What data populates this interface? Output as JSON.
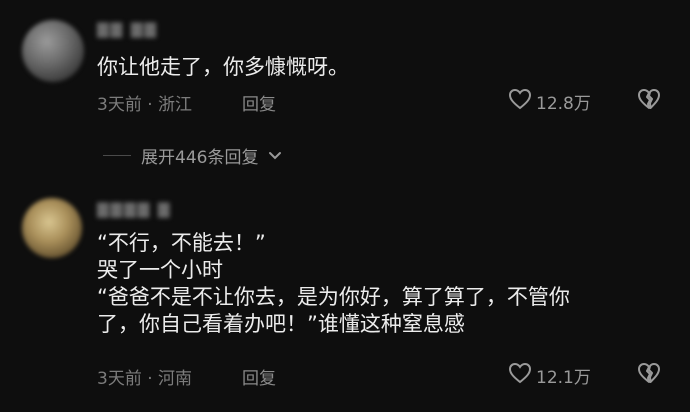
{
  "comments": [
    {
      "username": "",
      "text": "你让他走了，你多慷慨呀。",
      "time_location": "3天前 · 浙江",
      "reply_label": "回复",
      "likes": "12.8万"
    },
    {
      "username": "",
      "text": "“不行，不能去！”\n哭了一个小时\n“爸爸不是不让你去，是为你好，算了算了，不管你\n了，你自己看着办吧！”谁懂这种窒息感",
      "time_location": "3天前 · 河南",
      "reply_label": "回复",
      "likes": "12.1万"
    }
  ],
  "expand_replies": {
    "label": "展开446条回复"
  },
  "icons": {
    "like": "heart-outline-icon",
    "dislike": "broken-heart-icon",
    "expand": "chevron-down-icon"
  },
  "colors": {
    "background": "#0e0e0e",
    "text": "#ececec",
    "meta": "#7c7c7c"
  }
}
